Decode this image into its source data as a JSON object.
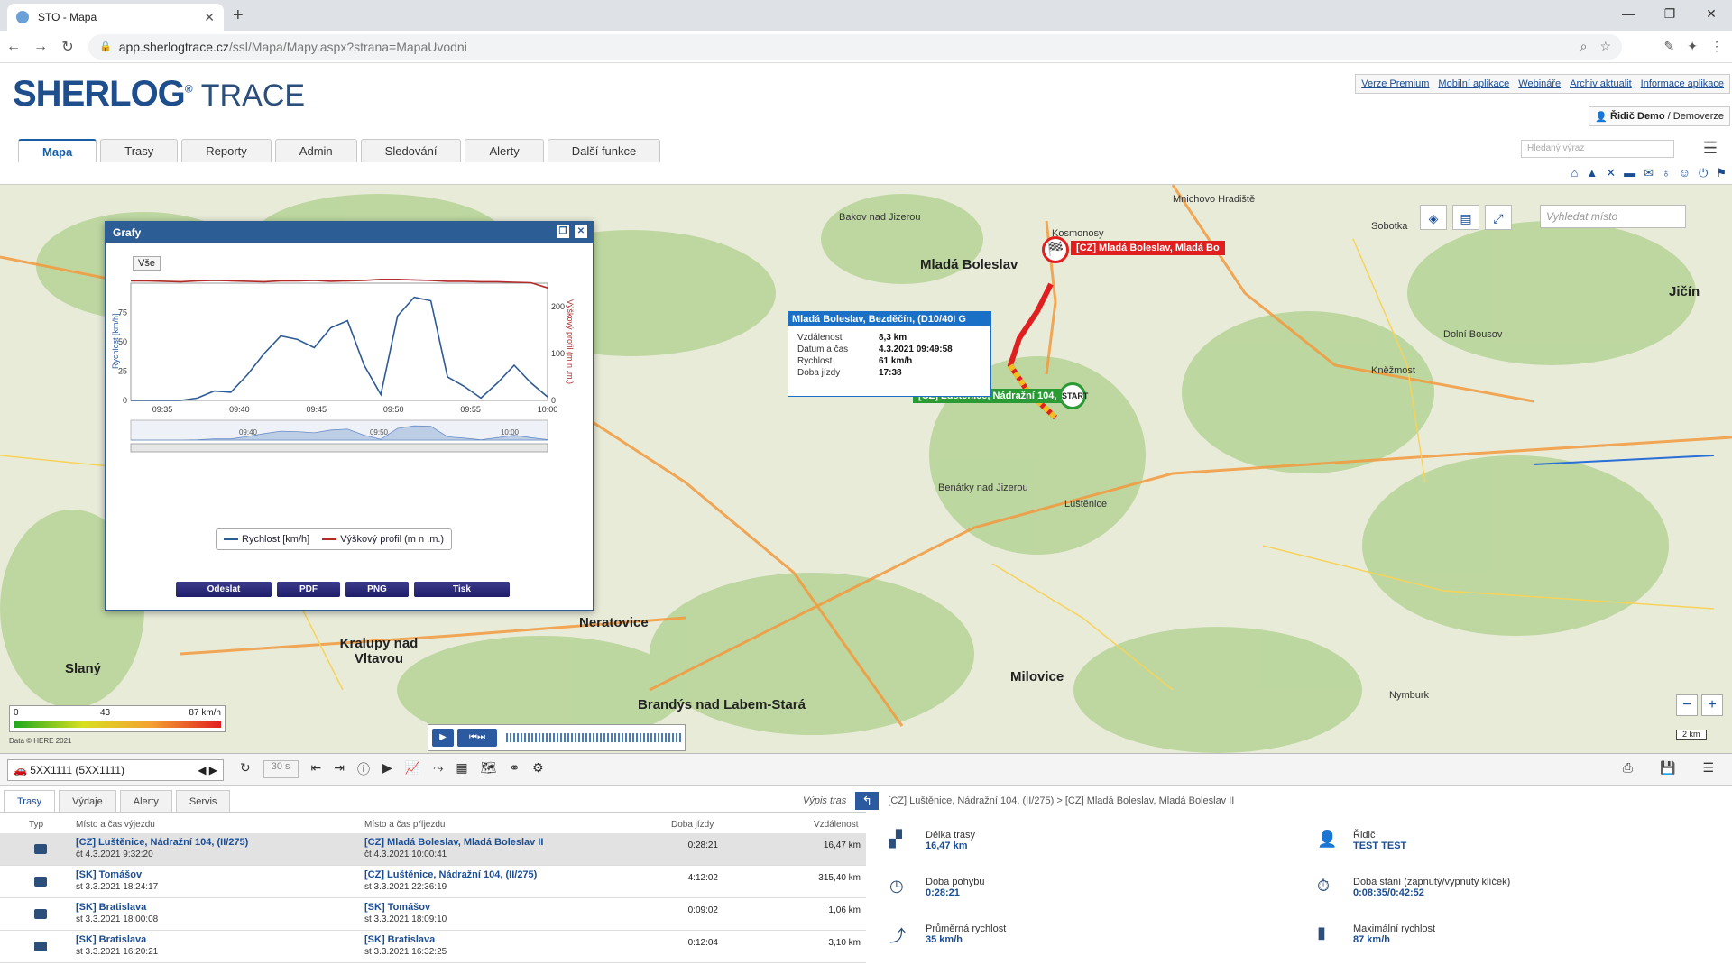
{
  "browser": {
    "tab_title": "STO - Mapa",
    "url_domain": "app.sherlogtrace.cz",
    "url_path": "/ssl/Mapa/Mapy.aspx?strana=MapaUvodni"
  },
  "header": {
    "logo_main": "SHERLOG",
    "logo_sup": "®",
    "logo_trace": "TRACE",
    "links": [
      "Verze Premium",
      "Mobilní aplikace",
      "Webináře",
      "Archiv aktualit",
      "Informace aplikace"
    ],
    "user": "Řidič Demo",
    "user_sep": "/",
    "account": "Demoverze",
    "search_placeholder": "Hledaný výraz"
  },
  "tabs": [
    "Mapa",
    "Trasy",
    "Reporty",
    "Admin",
    "Sledování",
    "Alerty",
    "Další funkce"
  ],
  "map": {
    "search_placeholder": "Vyhledat místo",
    "towns": [
      {
        "name": "Mladá Boleslav",
        "big": true
      },
      {
        "name": "Neratovice",
        "big": true
      },
      {
        "name": "Milovice",
        "big": true
      },
      {
        "name": "Kralupy nad Vltavou",
        "big": true
      },
      {
        "name": "Slaný",
        "big": true
      },
      {
        "name": "Brandýs nad Labem-Stará",
        "big": true
      },
      {
        "name": "Jičín",
        "big": true
      },
      {
        "name": "Bakov nad Jizerou",
        "big": false
      },
      {
        "name": "Kosmonosy",
        "big": false
      },
      {
        "name": "Luštěnice",
        "big": false
      },
      {
        "name": "Benátky nad Jizerou",
        "big": false
      },
      {
        "name": "Sobotka",
        "big": false
      },
      {
        "name": "Mnichovo Hradiště",
        "big": false
      },
      {
        "name": "Dolní Bousov",
        "big": false
      },
      {
        "name": "Kněžmost",
        "big": false
      },
      {
        "name": "Nymburk",
        "big": false
      }
    ],
    "speed_legend": {
      "min": "0",
      "mid": "43",
      "max": "87 km/h",
      "credit": "Data © HERE 2021"
    },
    "scale": "2 km",
    "popup": {
      "title": "Mladá Boleslav, Bezděčín, (D10/40I G",
      "rows": [
        {
          "k": "Vzdálenost",
          "v": "8,3 km"
        },
        {
          "k": "Datum a čas",
          "v": "4.3.2021 09:49:58"
        },
        {
          "k": "Rychlost",
          "v": "61 km/h"
        },
        {
          "k": "Doba jízdy",
          "v": "17:38"
        }
      ]
    },
    "start_label": "[CZ] Luštěnice, Nádražní 104, (",
    "start_marker": "START",
    "end_label": "[CZ] Mladá Boleslav, Mladá Bo",
    "end_marker": "🏁"
  },
  "grafy": {
    "title": "Grafy",
    "range_btn": "Vše",
    "ylabel_left": "Rychlost [km/h]",
    "ylabel_right": "Výškový profil (m n .m.)",
    "legend_speed": "Rychlost [km/h]",
    "legend_elev": "Výškový profil (m n .m.)",
    "buttons": [
      "Odeslat",
      "PDF",
      "PNG",
      "Tisk"
    ],
    "navigator_ticks": [
      "09:40",
      "09:50",
      "10:00"
    ]
  },
  "chart_data": {
    "type": "line",
    "x": [
      "09:32",
      "09:34",
      "09:36",
      "09:38",
      "09:40",
      "09:41",
      "09:42",
      "09:43",
      "09:44",
      "09:45",
      "09:46",
      "09:47",
      "09:48",
      "09:49",
      "09:49.5",
      "09:50",
      "09:51",
      "09:52",
      "09:53",
      "09:54",
      "09:55",
      "09:56",
      "09:57",
      "09:58",
      "09:59",
      "10:00"
    ],
    "x_ticks": [
      "09:35",
      "09:40",
      "09:45",
      "09:50",
      "09:55",
      "10:00"
    ],
    "series": [
      {
        "name": "Rychlost [km/h]",
        "axis": "left",
        "color": "#2e5a96",
        "values": [
          0,
          0,
          0,
          0,
          2,
          8,
          7,
          22,
          40,
          55,
          52,
          45,
          62,
          68,
          30,
          5,
          72,
          88,
          85,
          20,
          12,
          2,
          15,
          30,
          15,
          3
        ]
      },
      {
        "name": "Výškový profil (m n .m.)",
        "axis": "right",
        "color": "#b22a2a",
        "values": [
          255,
          255,
          254,
          253,
          255,
          256,
          255,
          254,
          253,
          255,
          255,
          256,
          254,
          255,
          256,
          258,
          258,
          257,
          256,
          254,
          254,
          253,
          253,
          252,
          251,
          240
        ]
      }
    ],
    "ylim_left": [
      0,
      100
    ],
    "yticks_left": [
      "0",
      "25",
      "50",
      "75"
    ],
    "ylim_right": [
      0,
      250
    ],
    "yticks_right": [
      "0",
      "100",
      "200"
    ]
  },
  "bottom": {
    "vehicle": "5XX1111 (5XX1111)",
    "interval": "30 s",
    "subtabs": [
      "Trasy",
      "Výdaje",
      "Alerty",
      "Servis"
    ],
    "vypis_tras": "Výpis tras",
    "route_path": "[CZ] Luštěnice, Nádražní 104, (II/275) > [CZ] Mladá Boleslav, Mladá Boleslav II",
    "columns": [
      "Typ",
      "Místo a čas výjezdu",
      "Místo a čas příjezdu",
      "Doba jízdy",
      "Vzdálenost"
    ],
    "rows": [
      {
        "from": "[CZ] Luštěnice, Nádražní 104, (II/275)",
        "from_t": "čt 4.3.2021 9:32:20",
        "to": "[CZ] Mladá Boleslav, Mladá Boleslav II",
        "to_t": "čt 4.3.2021 10:00:41",
        "dur": "0:28:21",
        "dist": "16,47 km",
        "sel": true
      },
      {
        "from": "[SK] Tomášov",
        "from_t": "st 3.3.2021 18:24:17",
        "to": "[CZ] Luštěnice, Nádražní 104, (II/275)",
        "to_t": "st 3.3.2021 22:36:19",
        "dur": "4:12:02",
        "dist": "315,40 km",
        "sel": false
      },
      {
        "from": "[SK] Bratislava",
        "from_t": "st 3.3.2021 18:00:08",
        "to": "[SK] Tomášov",
        "to_t": "st 3.3.2021 18:09:10",
        "dur": "0:09:02",
        "dist": "1,06 km",
        "sel": false
      },
      {
        "from": "[SK] Bratislava",
        "from_t": "st 3.3.2021 16:20:21",
        "to": "[SK] Bratislava",
        "to_t": "st 3.3.2021 16:32:25",
        "dur": "0:12:04",
        "dist": "3,10 km",
        "sel": false
      }
    ],
    "stats": [
      {
        "label": "Délka trasy",
        "value": "16,47 km",
        "icon": "map-icon"
      },
      {
        "label": "Řidič",
        "value": "TEST TEST",
        "icon": "driver-icon"
      },
      {
        "label": "Doba pohybu",
        "value": "0:28:21",
        "icon": "clock-icon"
      },
      {
        "label": "Doba stání (zapnutý/vypnutý klíček)",
        "value": "0:08:35/0:42:52",
        "icon": "stopwatch-icon"
      },
      {
        "label": "Průměrná rychlost",
        "value": "35 km/h",
        "icon": "trend-icon"
      },
      {
        "label": "Maximální rychlost",
        "value": "87 km/h",
        "icon": "bars-icon"
      }
    ]
  }
}
